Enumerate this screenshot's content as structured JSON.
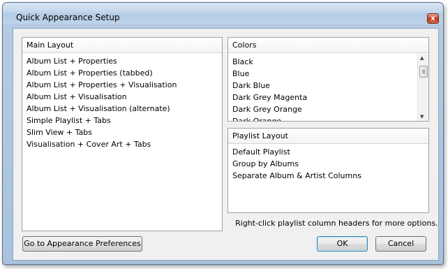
{
  "window": {
    "title": "Quick Appearance Setup",
    "close_symbol": "x"
  },
  "main_layout": {
    "header": "Main Layout",
    "items": [
      "Album List + Properties",
      "Album List + Properties (tabbed)",
      "Album List + Properties + Visualisation",
      "Album List + Visualisation",
      "Album List + Visualisation (alternate)",
      "Simple Playlist + Tabs",
      "Slim View + Tabs",
      "Visualisation + Cover Art + Tabs"
    ]
  },
  "colors": {
    "header": "Colors",
    "items": [
      "Black",
      "Blue",
      "Dark Blue",
      "Dark Grey Magenta",
      "Dark Grey Orange",
      "Dark Orange"
    ]
  },
  "playlist_layout": {
    "header": "Playlist Layout",
    "items": [
      "Default Playlist",
      "Group by Albums",
      "Separate Album & Artist Columns"
    ]
  },
  "hint_text": "Right-click playlist column headers for more options.",
  "buttons": {
    "preferences": "Go to Appearance Preferences",
    "ok": "OK",
    "cancel": "Cancel"
  }
}
